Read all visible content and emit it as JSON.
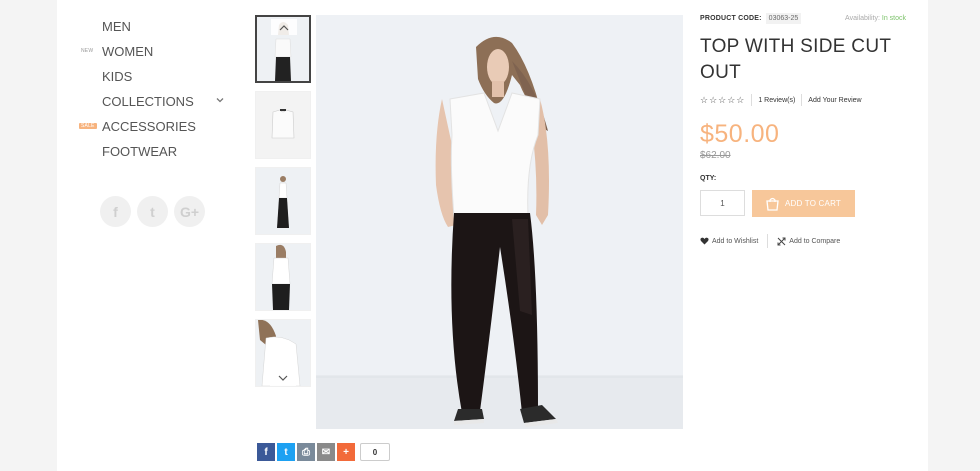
{
  "nav": {
    "items": [
      {
        "label": "MEN",
        "badge": ""
      },
      {
        "label": "WOMEN",
        "badge": "NEW"
      },
      {
        "label": "KIDS",
        "badge": ""
      },
      {
        "label": "COLLECTIONS",
        "badge": ""
      },
      {
        "label": "ACCESSORIES",
        "badge": "SALE"
      },
      {
        "label": "FOOTWEAR",
        "badge": ""
      }
    ]
  },
  "social": [
    {
      "icon": "facebook-icon",
      "glyph": "f"
    },
    {
      "icon": "twitter-icon",
      "glyph": "t"
    },
    {
      "icon": "google-plus-icon",
      "glyph": "G+"
    }
  ],
  "product": {
    "code_label": "PRODUCT CODE:",
    "code": "03063-25",
    "availability_label": "Availability:",
    "availability_value": "In stock",
    "title": "TOP WITH SIDE CUT OUT",
    "rating": 0,
    "reviews_link": "1 Review(s)",
    "add_review_link": "Add Your Review",
    "price": "$50.00",
    "old_price": "$62.00",
    "qty_label": "QTY:",
    "qty_value": "1",
    "add_to_cart": "ADD TO CART",
    "wishlist": "Add to Wishlist",
    "compare": "Add to Compare"
  },
  "share": {
    "buttons": [
      {
        "icon": "facebook-share-icon",
        "glyph": "f",
        "color": "#3b5998"
      },
      {
        "icon": "twitter-share-icon",
        "glyph": "t",
        "color": "#1da1f2"
      },
      {
        "icon": "print-icon",
        "glyph": "⎙",
        "color": "#7a8a9a"
      },
      {
        "icon": "email-icon",
        "glyph": "✉",
        "color": "#8a8a8a"
      },
      {
        "icon": "more-share-icon",
        "glyph": "+",
        "color": "#f26a3a"
      }
    ],
    "count": "0"
  },
  "colors": {
    "accent": "#f7b37e",
    "button": "#f7c79a",
    "in_stock": "#7cc26a"
  }
}
